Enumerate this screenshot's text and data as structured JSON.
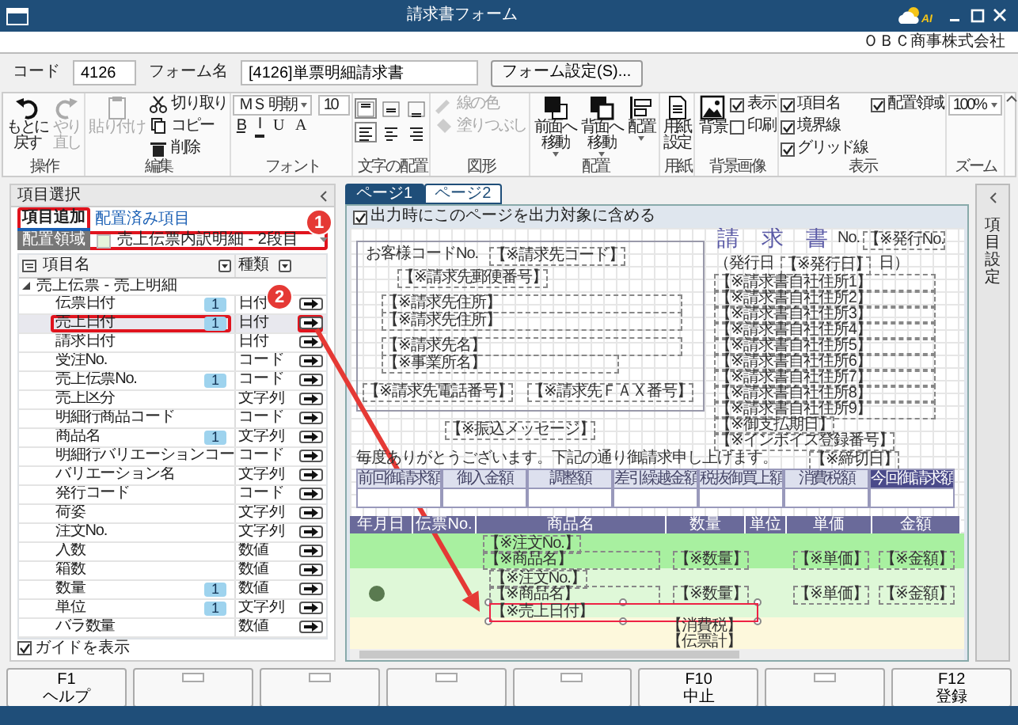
{
  "window": {
    "title": "請求書フォーム",
    "logo_text": "AI"
  },
  "company": "ＯＢＣ商事株式会社",
  "form": {
    "code_label": "コード",
    "code": "4126",
    "name_label": "フォーム名",
    "name": "[4126]単票明細請求書",
    "settings_button": "フォーム設定(S)..."
  },
  "ribbon": {
    "groups": [
      {
        "label": "操作",
        "kind": "row",
        "items": [
          {
            "kind": "big",
            "lines": [
              "もとに",
              "戻す"
            ],
            "disabled": false
          },
          {
            "kind": "big",
            "lines": [
              "やり",
              "直し"
            ],
            "disabled": true
          }
        ]
      },
      {
        "label": "編集",
        "kind": "row",
        "items": [
          {
            "kind": "big",
            "lines": [
              "貼り付け"
            ],
            "disabled": true
          },
          {
            "kind": "small",
            "label": "切り取り",
            "disabled": false
          },
          {
            "kind": "small",
            "label": "コピー",
            "disabled": false
          },
          {
            "kind": "small",
            "label": "削除",
            "disabled": false
          }
        ]
      },
      {
        "label": "フォント",
        "kind": "stack",
        "items": [
          {
            "kind": "select",
            "value": "ＭＳ 明朝"
          },
          {
            "kind": "input",
            "value": "10"
          },
          {
            "kind": "fmt",
            "label": "B"
          },
          {
            "kind": "fmt",
            "label": "I"
          },
          {
            "kind": "fmt",
            "label": "U"
          },
          {
            "kind": "fmt",
            "label": "A"
          }
        ]
      },
      {
        "label": "文字の配置",
        "kind": "row",
        "items": [
          {
            "kind": "align",
            "selected": true
          },
          {
            "kind": "align",
            "selected": false
          },
          {
            "kind": "align",
            "selected": false
          },
          {
            "kind": "align",
            "selected": true
          },
          {
            "kind": "align",
            "selected": false
          },
          {
            "kind": "align",
            "selected": false
          }
        ]
      },
      {
        "label": "図形",
        "kind": "row",
        "items": [
          {
            "kind": "small",
            "label": "線の色",
            "disabled": true
          },
          {
            "kind": "small",
            "label": "塗りつぶし",
            "disabled": true
          }
        ]
      },
      {
        "label": "配置",
        "kind": "row",
        "items": [
          {
            "kind": "big",
            "lines": [
              "前面へ",
              "移動"
            ],
            "dropdown": true,
            "disabled": false
          },
          {
            "kind": "big",
            "lines": [
              "背面へ",
              "移動"
            ],
            "dropdown": true,
            "disabled": false
          },
          {
            "kind": "big",
            "lines": [
              "配置"
            ],
            "dropdown": true,
            "disabled": false
          }
        ]
      },
      {
        "label": "用紙",
        "kind": "row",
        "items": [
          {
            "kind": "big",
            "lines": [
              "用紙",
              "設定"
            ],
            "disabled": false
          }
        ]
      },
      {
        "label": "背景画像",
        "kind": "row",
        "items": [
          {
            "kind": "big",
            "lines": [
              "背景"
            ],
            "disabled": false
          },
          {
            "kind": "check",
            "label": "表示",
            "checked": true
          },
          {
            "kind": "check",
            "label": "印刷",
            "checked": false
          }
        ]
      },
      {
        "label": "表示",
        "kind": "row",
        "items": [
          {
            "kind": "check",
            "label": "項目名",
            "checked": true
          },
          {
            "kind": "check",
            "label": "境界線",
            "checked": true
          },
          {
            "kind": "check",
            "label": "グリッド線",
            "checked": true
          },
          {
            "kind": "check",
            "label": "配置領域",
            "checked": true
          }
        ]
      },
      {
        "label": "ズーム",
        "kind": "row",
        "items": [
          {
            "kind": "select",
            "value": "100%"
          }
        ]
      }
    ]
  },
  "left_panel": {
    "title": "項目選択",
    "tabs": [
      {
        "label": "項目追加",
        "selected": true,
        "highlighted": true
      },
      {
        "label": "配置済み項目",
        "selected": false,
        "highlighted": false
      }
    ],
    "area": {
      "label": "配置領域",
      "value": "売上伝票内訳明細 - 2段目",
      "color": "#e6f5dc",
      "highlighted": true
    },
    "columns": [
      "項目名",
      "種類"
    ],
    "group": {
      "label": "売上伝票 - 売上明細",
      "expanded": true
    },
    "rows": [
      {
        "name": "伝票日付",
        "badge": "1",
        "type": "日付",
        "selected": false,
        "highlighted": false
      },
      {
        "name": "売上日付",
        "badge": "1",
        "type": "日付",
        "selected": true,
        "highlighted": true
      },
      {
        "name": "請求日付",
        "type": "日付",
        "selected": false,
        "highlighted": false
      },
      {
        "name": "受注No.",
        "type": "コード",
        "selected": false,
        "highlighted": false
      },
      {
        "name": "売上伝票No.",
        "badge": "1",
        "type": "コード",
        "selected": false,
        "highlighted": false
      },
      {
        "name": "売上区分",
        "type": "文字列",
        "selected": false,
        "highlighted": false
      },
      {
        "name": "明細行商品コード",
        "type": "コード",
        "selected": false,
        "highlighted": false
      },
      {
        "name": "商品名",
        "badge": "1",
        "type": "文字列",
        "selected": false,
        "highlighted": false
      },
      {
        "name": "明細行バリエーションコー",
        "type": "コード",
        "selected": false,
        "highlighted": false
      },
      {
        "name": "バリエーション名",
        "type": "文字列",
        "selected": false,
        "highlighted": false
      },
      {
        "name": "発行コード",
        "type": "コード",
        "selected": false,
        "highlighted": false
      },
      {
        "name": "荷姿",
        "type": "文字列",
        "selected": false,
        "highlighted": false
      },
      {
        "name": "注文No.",
        "type": "文字列",
        "selected": false,
        "highlighted": false
      },
      {
        "name": "入数",
        "type": "数値",
        "selected": false,
        "highlighted": false
      },
      {
        "name": "箱数",
        "type": "数値",
        "selected": false,
        "highlighted": false
      },
      {
        "name": "数量",
        "badge": "1",
        "type": "数値",
        "selected": false,
        "highlighted": false
      },
      {
        "name": "単位",
        "badge": "1",
        "type": "文字列",
        "selected": false,
        "highlighted": false
      },
      {
        "name": "バラ数量",
        "type": "数値",
        "selected": false,
        "highlighted": false
      }
    ],
    "guide": {
      "label": "ガイドを表示",
      "checked": true
    }
  },
  "pages": {
    "tabs": [
      {
        "label": "ページ1",
        "selected": true
      },
      {
        "label": "ページ2",
        "selected": false
      }
    ],
    "include": {
      "label": "出力時にこのページを出力対象に含める",
      "checked": true
    },
    "canvas": {
      "items": [
        {
          "kind": "title",
          "text": "請　求　書"
        },
        {
          "kind": "label",
          "text": "お客様コードNo."
        },
        {
          "kind": "field",
          "text": "【※請求先コード】",
          "selected": false
        },
        {
          "kind": "field",
          "text": "【※請求先郵便番号】",
          "selected": false
        },
        {
          "kind": "field",
          "text": "【※請求先住所】",
          "selected": false
        },
        {
          "kind": "field",
          "text": "【※請求先住所】",
          "selected": false
        },
        {
          "kind": "field",
          "text": "【※請求先名】",
          "selected": false
        },
        {
          "kind": "field",
          "text": "【※事業所名】",
          "selected": false
        },
        {
          "kind": "field",
          "text": "【※請求先電話番号】",
          "selected": false
        },
        {
          "kind": "field",
          "text": "【※請求先ＦＡＸ番号】",
          "selected": false
        },
        {
          "kind": "label",
          "text": "（発行日"
        },
        {
          "kind": "field",
          "text": "【※発行日】",
          "selected": false
        },
        {
          "kind": "label",
          "text": "日）"
        },
        {
          "kind": "label",
          "text": "No."
        },
        {
          "kind": "field",
          "text": "【※発行No.",
          "selected": false
        },
        {
          "kind": "field",
          "text": "【※請求書自社住所1】",
          "selected": false
        },
        {
          "kind": "field",
          "text": "【※請求書自社住所2】",
          "selected": false
        },
        {
          "kind": "field",
          "text": "【※請求書自社住所3】",
          "selected": false
        },
        {
          "kind": "field",
          "text": "【※請求書自社住所4】",
          "selected": false
        },
        {
          "kind": "field",
          "text": "【※請求書自社住所5】",
          "selected": false
        },
        {
          "kind": "field",
          "text": "【※請求書自社住所6】",
          "selected": false
        },
        {
          "kind": "field",
          "text": "【※請求書自社住所7】",
          "selected": false
        },
        {
          "kind": "field",
          "text": "【※請求書自社住所8】",
          "selected": false
        },
        {
          "kind": "field",
          "text": "【※請求書自社住所9】",
          "selected": false
        },
        {
          "kind": "field",
          "text": "【※御支払期日】",
          "selected": false
        },
        {
          "kind": "field",
          "text": "【※インボイス登録番号】",
          "selected": false
        },
        {
          "kind": "field",
          "text": "【※振込メッセージ】",
          "selected": false
        },
        {
          "kind": "label",
          "text": "毎度ありがとうございます。下記の通り御請求申し上げます。"
        },
        {
          "kind": "field",
          "text": "【※締切日】",
          "selected": false
        },
        {
          "kind": "field",
          "text": "【※注文No.】",
          "selected": false
        },
        {
          "kind": "field",
          "text": "【※商品名】",
          "selected": false
        },
        {
          "kind": "field",
          "text": "【※数量】",
          "selected": false
        },
        {
          "kind": "field",
          "text": "【※単価】",
          "selected": false
        },
        {
          "kind": "field",
          "text": "【※金額】",
          "selected": false
        },
        {
          "kind": "field",
          "text": "【※注文No.】",
          "selected": false
        },
        {
          "kind": "field",
          "text": "【※商品名】",
          "selected": false
        },
        {
          "kind": "field",
          "text": "【※数量】",
          "selected": false
        },
        {
          "kind": "field",
          "text": "【※単価】",
          "selected": false
        },
        {
          "kind": "field",
          "text": "【※金額】",
          "selected": false
        },
        {
          "kind": "field",
          "text": "【※売上日付】",
          "selected": true
        },
        {
          "kind": "label",
          "text": "【消費税】"
        },
        {
          "kind": "label",
          "text": "【伝票計】"
        }
      ],
      "summary_columns": [
        {
          "label": "前回御請求額",
          "emphasis": false
        },
        {
          "label": "御入金額",
          "emphasis": false
        },
        {
          "label": "調整額",
          "emphasis": false
        },
        {
          "label": "差引繰越金額",
          "emphasis": false
        },
        {
          "label": "税抜御買上額",
          "emphasis": false
        },
        {
          "label": "消費税額",
          "emphasis": false
        },
        {
          "label": "今回御請求額",
          "emphasis": true
        }
      ],
      "detail_columns": [
        "年月日",
        "伝票No.",
        "商品名",
        "数量",
        "単位",
        "単価",
        "金額"
      ]
    }
  },
  "right_panel": {
    "title": "項目設定"
  },
  "callouts": [
    {
      "number": "1"
    },
    {
      "number": "2"
    }
  ],
  "function_keys": [
    {
      "kind": "key",
      "key": "F1",
      "label": "ヘルプ"
    },
    {
      "kind": "blank"
    },
    {
      "kind": "blank"
    },
    {
      "kind": "blank"
    },
    {
      "kind": "blank"
    },
    {
      "kind": "key",
      "key": "F10",
      "label": "中止"
    },
    {
      "kind": "blank"
    },
    {
      "kind": "key",
      "key": "F12",
      "label": "登録"
    }
  ]
}
